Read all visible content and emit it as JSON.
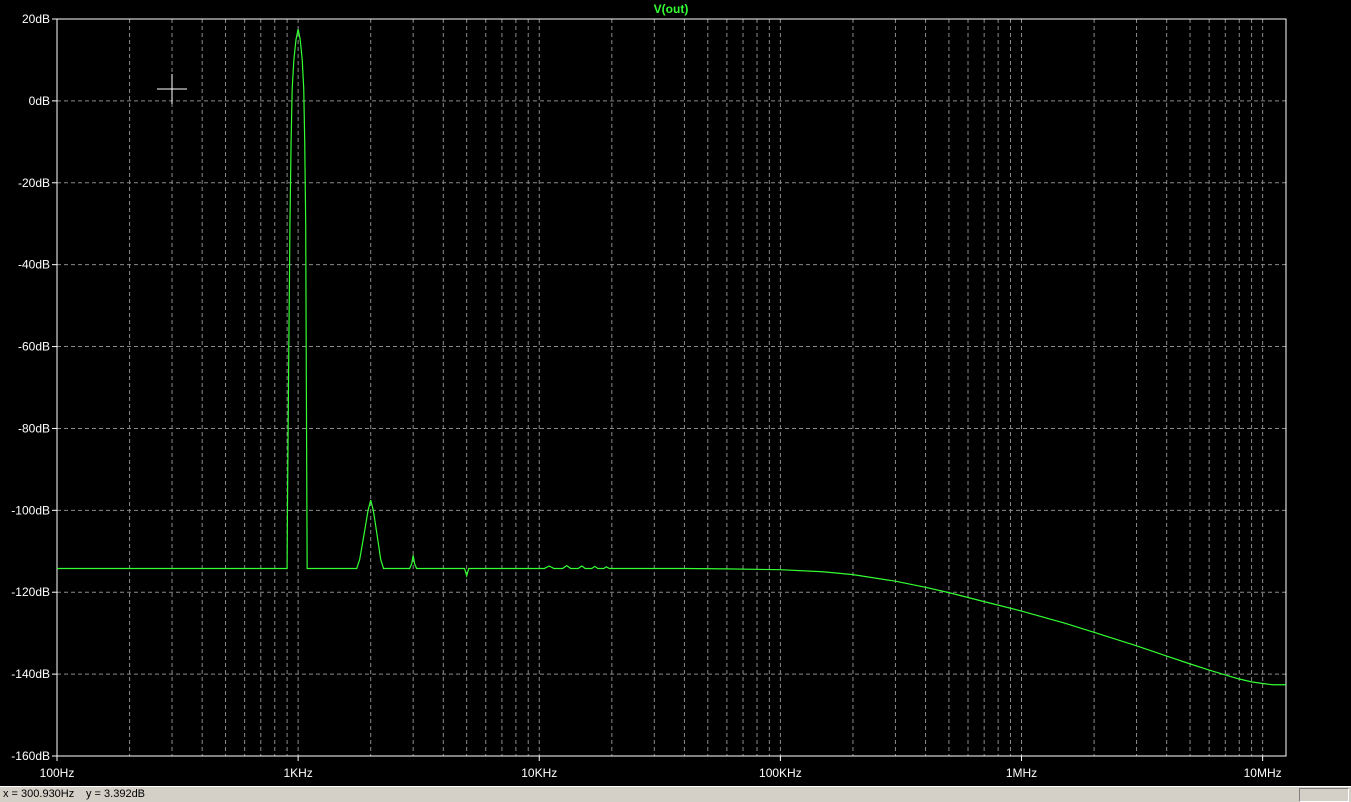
{
  "window": {
    "trace_name": "V(out)"
  },
  "status": {
    "x_readout": "x = 300.930Hz",
    "y_readout": "y = 3.392dB"
  },
  "colors": {
    "background": "#000000",
    "trace": "#33ff33",
    "grid": "#8a8a8a",
    "axes": "#ffffff",
    "title": "#33ff33"
  },
  "chart_data": {
    "type": "line",
    "title": "V(out)",
    "xlabel": "",
    "ylabel": "",
    "x_scale": "log",
    "xlim": [
      100,
      12500000
    ],
    "ylim": [
      -160,
      20
    ],
    "grid": true,
    "x_ticks": [
      {
        "value": 100,
        "label": "100Hz"
      },
      {
        "value": 1000,
        "label": "1KHz"
      },
      {
        "value": 10000,
        "label": "10KHz"
      },
      {
        "value": 100000,
        "label": "100KHz"
      },
      {
        "value": 1000000,
        "label": "1MHz"
      },
      {
        "value": 10000000,
        "label": "10MHz"
      }
    ],
    "y_ticks": [
      {
        "value": 20,
        "label": "20dB"
      },
      {
        "value": 0,
        "label": "0dB"
      },
      {
        "value": -20,
        "label": "-20dB"
      },
      {
        "value": -40,
        "label": "-40dB"
      },
      {
        "value": -60,
        "label": "-60dB"
      },
      {
        "value": -80,
        "label": "-80dB"
      },
      {
        "value": -100,
        "label": "-100dB"
      },
      {
        "value": -120,
        "label": "-120dB"
      },
      {
        "value": -140,
        "label": "-140dB"
      },
      {
        "value": -160,
        "label": "-160dB"
      }
    ],
    "series": [
      {
        "name": "V(out)",
        "points": [
          [
            100,
            -114.2
          ],
          [
            900,
            -114.2
          ],
          [
            903,
            -100
          ],
          [
            915,
            -60
          ],
          [
            925,
            -30
          ],
          [
            935,
            -10
          ],
          [
            945,
            3
          ],
          [
            960,
            10
          ],
          [
            980,
            15
          ],
          [
            1000,
            17.5
          ],
          [
            1020,
            15
          ],
          [
            1040,
            10
          ],
          [
            1055,
            3
          ],
          [
            1065,
            -10
          ],
          [
            1075,
            -30
          ],
          [
            1080,
            -60
          ],
          [
            1090,
            -114.2
          ],
          [
            1700,
            -114.2
          ],
          [
            1750,
            -114.2
          ],
          [
            1800,
            -112
          ],
          [
            1850,
            -108
          ],
          [
            1900,
            -104
          ],
          [
            1950,
            -100
          ],
          [
            2000,
            -97.5
          ],
          [
            2050,
            -100
          ],
          [
            2100,
            -104
          ],
          [
            2150,
            -108
          ],
          [
            2200,
            -112
          ],
          [
            2260,
            -114.2
          ],
          [
            2900,
            -114.2
          ],
          [
            2960,
            -113
          ],
          [
            3000,
            -111
          ],
          [
            3040,
            -113
          ],
          [
            3100,
            -114.2
          ],
          [
            4900,
            -114.2
          ],
          [
            5000,
            -116
          ],
          [
            5100,
            -114.2
          ],
          [
            10500,
            -114.2
          ],
          [
            11000,
            -113.6
          ],
          [
            11500,
            -114.2
          ],
          [
            12500,
            -114.2
          ],
          [
            13000,
            -113.5
          ],
          [
            13500,
            -114.2
          ],
          [
            14500,
            -114.2
          ],
          [
            15000,
            -113.6
          ],
          [
            15500,
            -114.2
          ],
          [
            16500,
            -114.2
          ],
          [
            17000,
            -113.7
          ],
          [
            17500,
            -114.2
          ],
          [
            18500,
            -114.2
          ],
          [
            19000,
            -113.8
          ],
          [
            19500,
            -114.2
          ],
          [
            30000,
            -114.2
          ],
          [
            40000,
            -114.2
          ],
          [
            60000,
            -114.3
          ],
          [
            100000,
            -114.5
          ],
          [
            150000,
            -115
          ],
          [
            200000,
            -115.7
          ],
          [
            300000,
            -117.3
          ],
          [
            400000,
            -118.8
          ],
          [
            500000,
            -120.1
          ],
          [
            700000,
            -122.3
          ],
          [
            1000000,
            -124.6
          ],
          [
            1500000,
            -127.5
          ],
          [
            2000000,
            -129.8
          ],
          [
            3000000,
            -133.1
          ],
          [
            4000000,
            -135.6
          ],
          [
            5000000,
            -137.5
          ],
          [
            6000000,
            -139
          ],
          [
            7000000,
            -140.2
          ],
          [
            8000000,
            -141.2
          ],
          [
            9000000,
            -141.9
          ],
          [
            10000000,
            -142.3
          ],
          [
            11000000,
            -142.6
          ],
          [
            12500000,
            -142.6
          ]
        ]
      }
    ]
  }
}
